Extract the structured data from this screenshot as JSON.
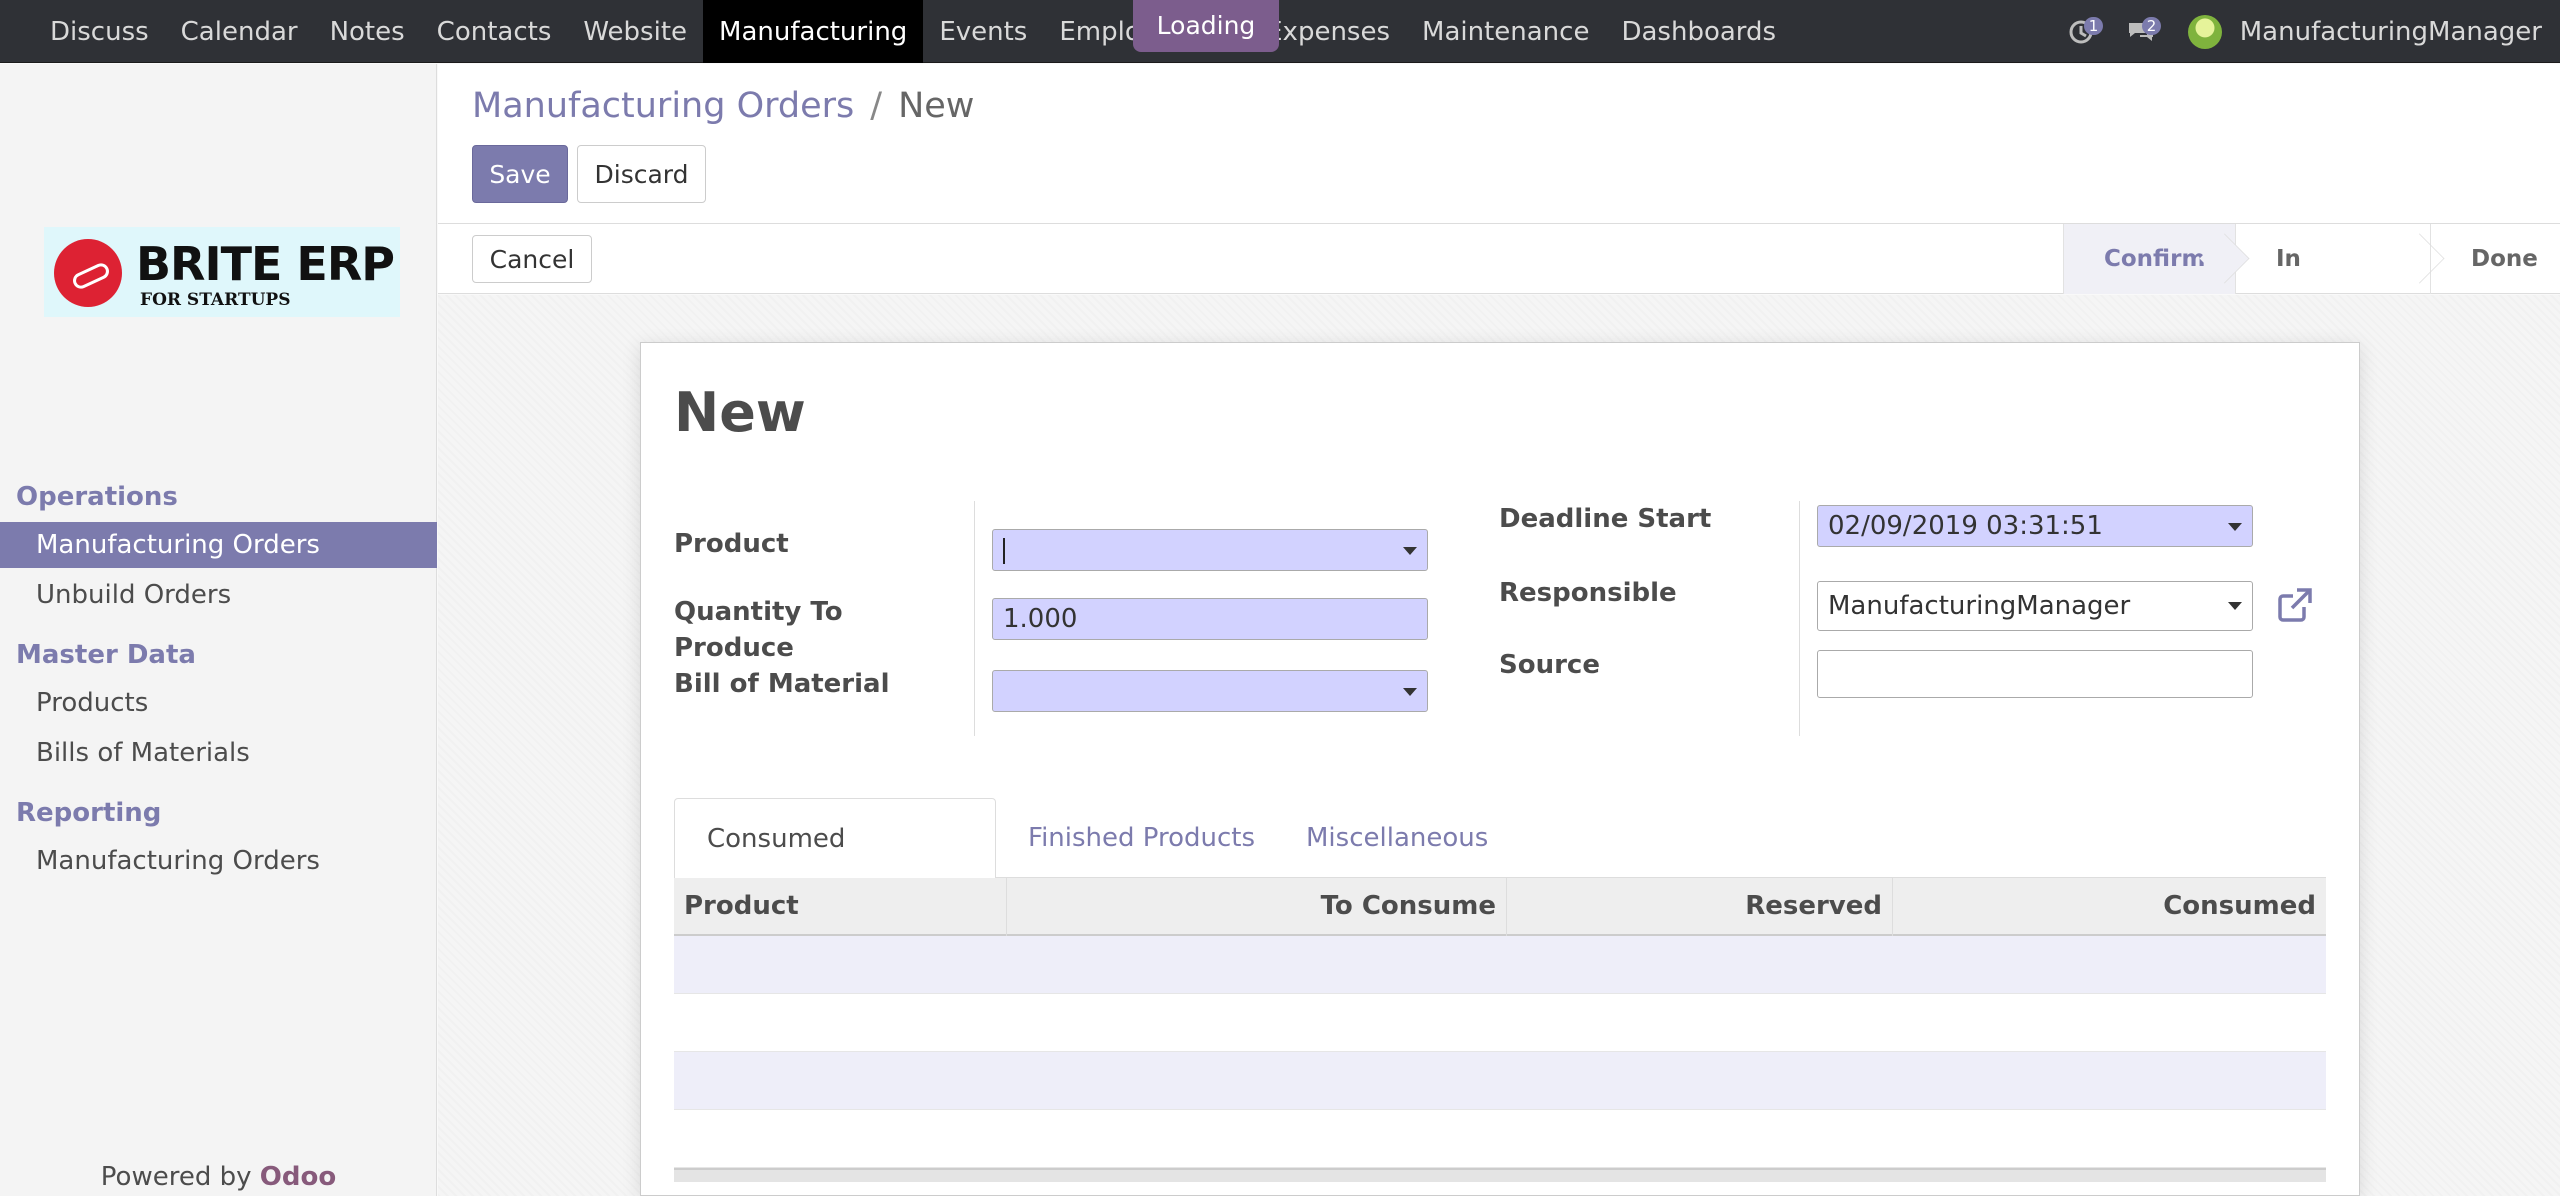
{
  "navbar": {
    "menu": [
      "Discuss",
      "Calendar",
      "Notes",
      "Contacts",
      "Website",
      "Manufacturing",
      "Events",
      "Employe",
      "Loading",
      "Expenses",
      "Maintenance",
      "Dashboards"
    ],
    "active": "Manufacturing",
    "loading_label": "Loading",
    "activity_count": "1",
    "message_count": "2",
    "user_name": "ManufacturingManager"
  },
  "sidebar": {
    "logo_title": "BRITE ERP",
    "logo_subtitle": "FOR STARTUPS",
    "sections": [
      {
        "title": "Operations",
        "items": [
          "Manufacturing Orders",
          "Unbuild Orders"
        ]
      },
      {
        "title": "Master Data",
        "items": [
          "Products",
          "Bills of Materials"
        ]
      },
      {
        "title": "Reporting",
        "items": [
          "Manufacturing Orders"
        ]
      }
    ],
    "active_item": "Manufacturing Orders",
    "powered_by": "Powered by",
    "powered_brand": "Odoo"
  },
  "breadcrumb": {
    "parent": "Manufacturing Orders",
    "separator": "/",
    "current": "New"
  },
  "buttons": {
    "save": "Save",
    "discard": "Discard",
    "cancel": "Cancel"
  },
  "stages": [
    "Confirmed",
    "In Progress",
    "Done"
  ],
  "current_stage": "Confirmed",
  "form": {
    "title": "New",
    "left_fields": {
      "product_label": "Product",
      "product_value": "",
      "quantity_label": "Quantity To Produce",
      "quantity_value": "1.000",
      "bom_label": "Bill of Material",
      "bom_value": ""
    },
    "right_fields": {
      "deadline_label": "Deadline Start",
      "deadline_value": "02/09/2019 03:31:51",
      "responsible_label": "Responsible",
      "responsible_value": "ManufacturingManager",
      "source_label": "Source",
      "source_value": ""
    }
  },
  "tabs": [
    "Consumed Materials",
    "Finished Products",
    "Miscellaneous"
  ],
  "active_tab": "Consumed Materials",
  "table": {
    "columns": [
      "Product",
      "To Consume",
      "Reserved",
      "Consumed"
    ],
    "rows": []
  },
  "colors": {
    "primary": "#7c7bad",
    "navbar": "#2f3136",
    "required_field": "#d2d2ff",
    "odoo_brand": "#875a7b"
  }
}
